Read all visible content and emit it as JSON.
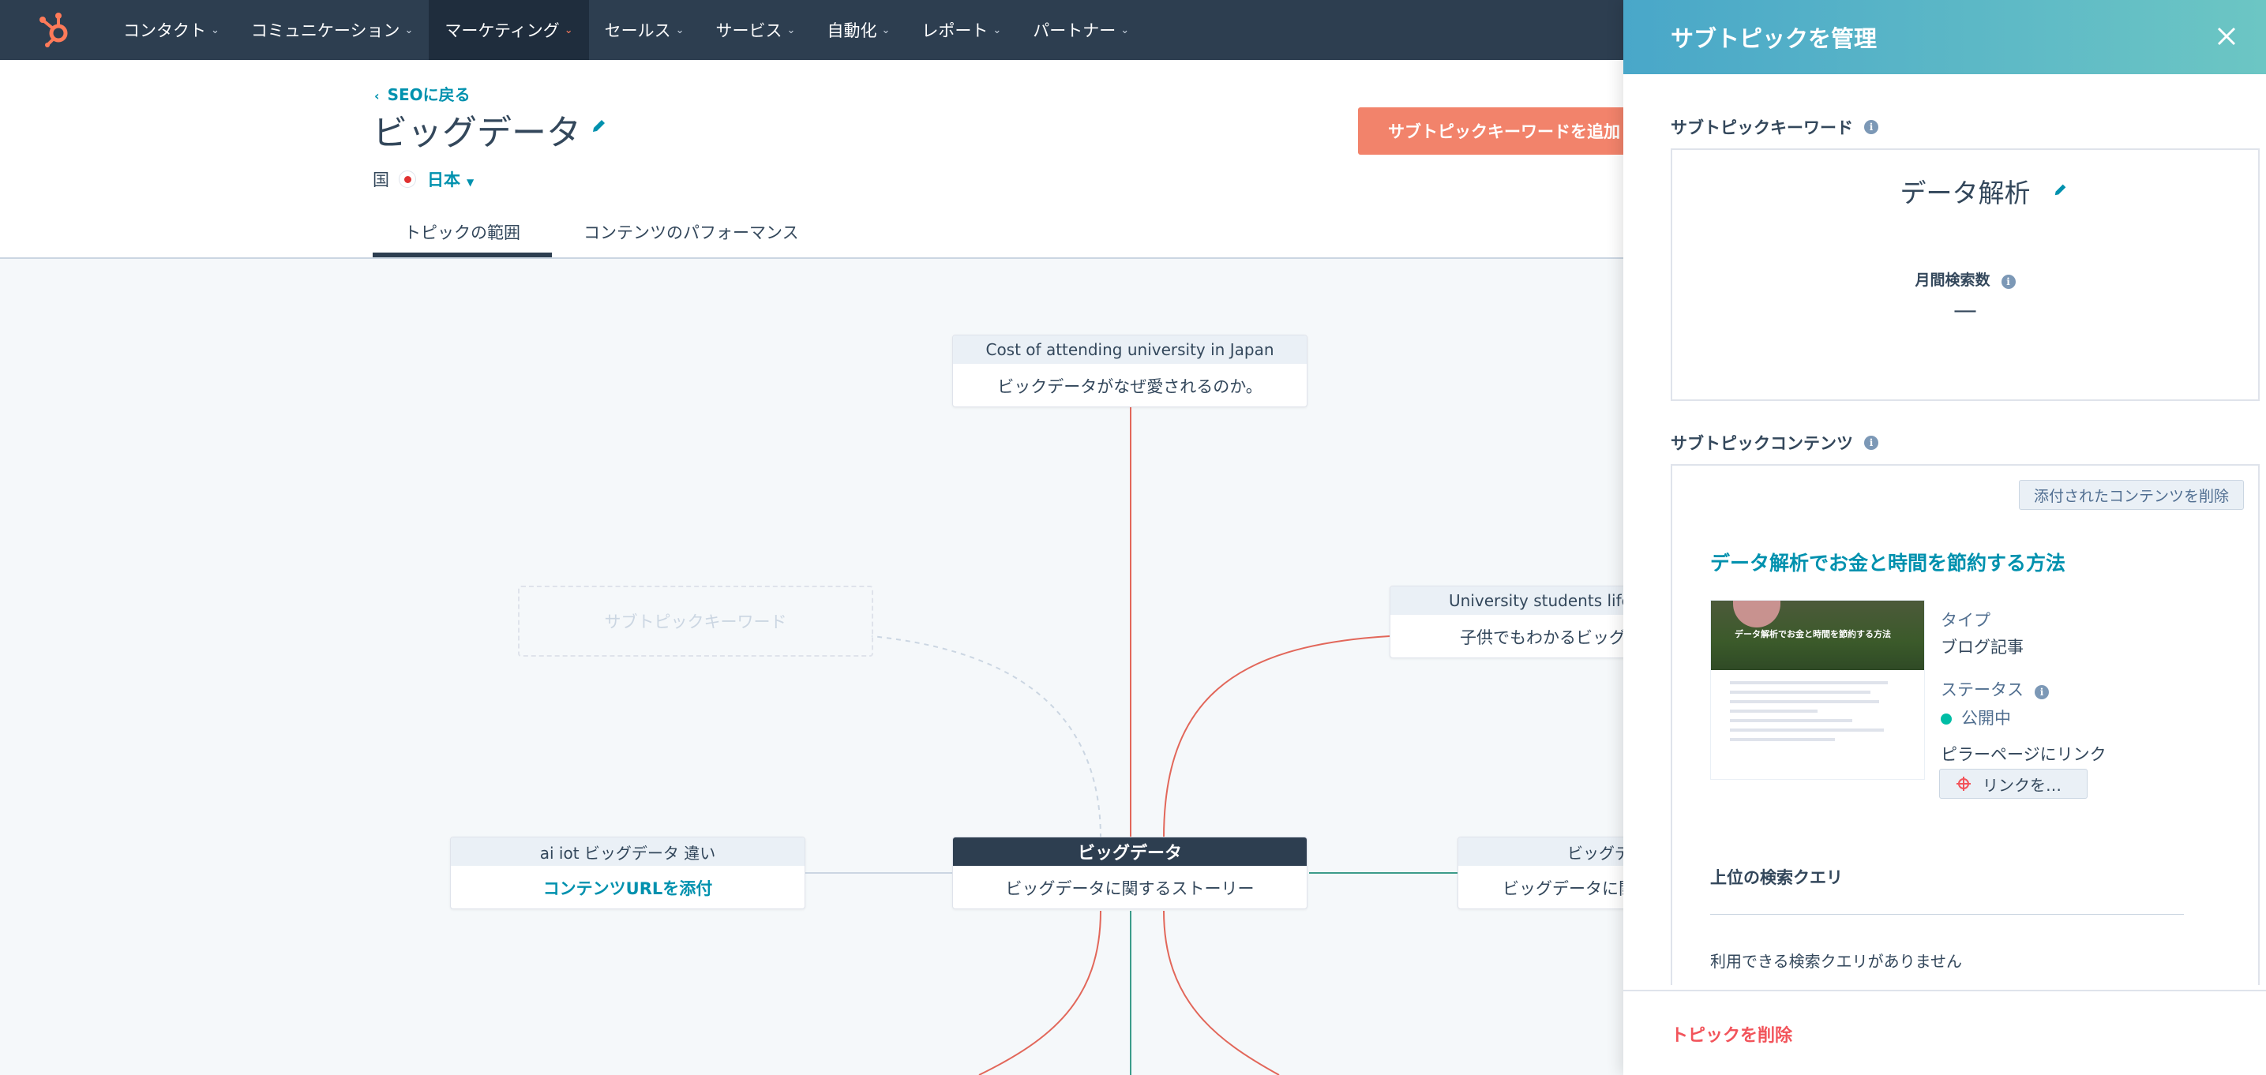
{
  "nav": {
    "logo": "hubspot-sprocket-icon",
    "items": [
      {
        "label": "コンタクト",
        "active": false
      },
      {
        "label": "コミュニケーション",
        "active": false
      },
      {
        "label": "マーケティング",
        "active": true
      },
      {
        "label": "セールス",
        "active": false
      },
      {
        "label": "サービス",
        "active": false
      },
      {
        "label": "自動化",
        "active": false
      },
      {
        "label": "レポート",
        "active": false
      },
      {
        "label": "パートナー",
        "active": false
      }
    ]
  },
  "header": {
    "back_label": "SEOに戻る",
    "title": "ビッグデータ",
    "country_label": "国",
    "country_value": "日本",
    "add_button": "サブトピックキーワードを追加",
    "tabs": [
      {
        "label": "トピックの範囲",
        "active": true
      },
      {
        "label": "コンテンツのパフォーマンス",
        "active": false
      }
    ]
  },
  "map": {
    "center": {
      "keyword": "ビッグデータ",
      "content": "ビッグデータに関するストーリー"
    },
    "top": {
      "keyword": "Cost of attending university in Japan",
      "content": "ビックデータがなぜ愛されるのか。"
    },
    "left": {
      "keyword": "ai iot ビッグデータ 違い",
      "content": "コンテンツURLを添付"
    },
    "right_top": {
      "keyword": "University students life i",
      "content": "子供でもわかるビッグ"
    },
    "right": {
      "keyword": "ビッグデ",
      "content": "ビッグデータに関"
    },
    "placeholder": "サブトピックキーワード"
  },
  "colors": {
    "nav_bg": "#2d3e50",
    "accent": "#ff7a59",
    "link": "#0091ae",
    "line_red": "#e2675a",
    "line_green": "#3c9c8a",
    "danger": "#f2545b"
  },
  "panel": {
    "title": "サブトピックを管理",
    "keyword_label": "サブトピックキーワード",
    "keyword_value": "データ解析",
    "volume_label": "月間検索数",
    "volume_value": "—",
    "content_label": "サブトピックコンテンツ",
    "detach_button": "添付されたコンテンツを削除",
    "post_title": "データ解析でお金と時間を節約する方法",
    "thumb_caption": "データ解析でお金と時間を節約する方法",
    "type_label": "タイプ",
    "type_value": "ブログ記事",
    "status_label": "ステータス",
    "status_value": "公開中",
    "pillar_label": "ピラーページにリンク",
    "link_button": "リンクを…",
    "queries_label": "上位の検索クエリ",
    "queries_empty": "利用できる検索クエリがありません",
    "delete_link": "トピックを削除"
  }
}
